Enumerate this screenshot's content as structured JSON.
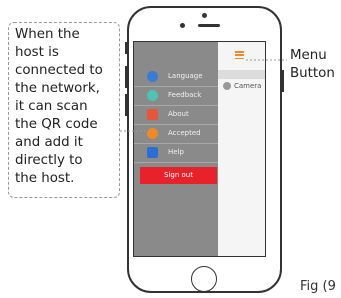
{
  "annotation": {
    "note_lines": [
      "When the",
      "host is",
      "connected to",
      "the network,",
      "it can scan",
      "the QR code",
      "and add it",
      "directly to",
      "the host."
    ],
    "menu_button_lines": [
      "Menu",
      "Button"
    ],
    "figure_label": "Fig (9"
  },
  "app": {
    "menu_items": [
      {
        "label": "Language",
        "icon": "language-icon",
        "color": "#3a7bd5"
      },
      {
        "label": "Feedback",
        "icon": "feedback-icon",
        "color": "#4fc3b4"
      },
      {
        "label": "About",
        "icon": "about-icon",
        "color": "#e8553a"
      },
      {
        "label": "Accepted",
        "icon": "accepted-icon",
        "color": "#f08a24"
      },
      {
        "label": "Help",
        "icon": "help-icon",
        "color": "#2b6fd6"
      }
    ],
    "sign_out_label": "Sign out",
    "device_label": "Camera"
  },
  "colors": {
    "menu_background": "#8a8a8a",
    "sign_out": "#e8222a",
    "menu_button": "#f08a24",
    "callout_line": "#999999"
  }
}
